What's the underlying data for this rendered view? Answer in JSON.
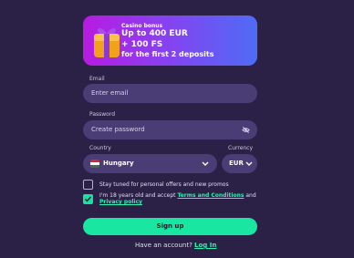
{
  "banner": {
    "label": "Casino bonus",
    "line1": "Up to 400 EUR",
    "line2": "+ 100 FS",
    "line3": "for the first 2 deposits"
  },
  "form": {
    "email_label": "Email",
    "email_placeholder": "Enter email",
    "password_label": "Password",
    "password_placeholder": "Create password",
    "country_label": "Country",
    "country_value": "Hungary",
    "currency_label": "Currency",
    "currency_value": "EUR",
    "promo_text": "Stay tuned for personal offers and new promos",
    "terms_prefix": "I'm 18 years old and accept",
    "terms_link": "Terms and Conditions",
    "terms_and": "and",
    "privacy_link": "Privacy policy",
    "signup_label": "Sign up",
    "account_text": "Have an account?",
    "login_link": "Log In"
  },
  "colors": {
    "background": "#2b2146",
    "field": "#4a3c74",
    "accent": "#19e6a0"
  }
}
